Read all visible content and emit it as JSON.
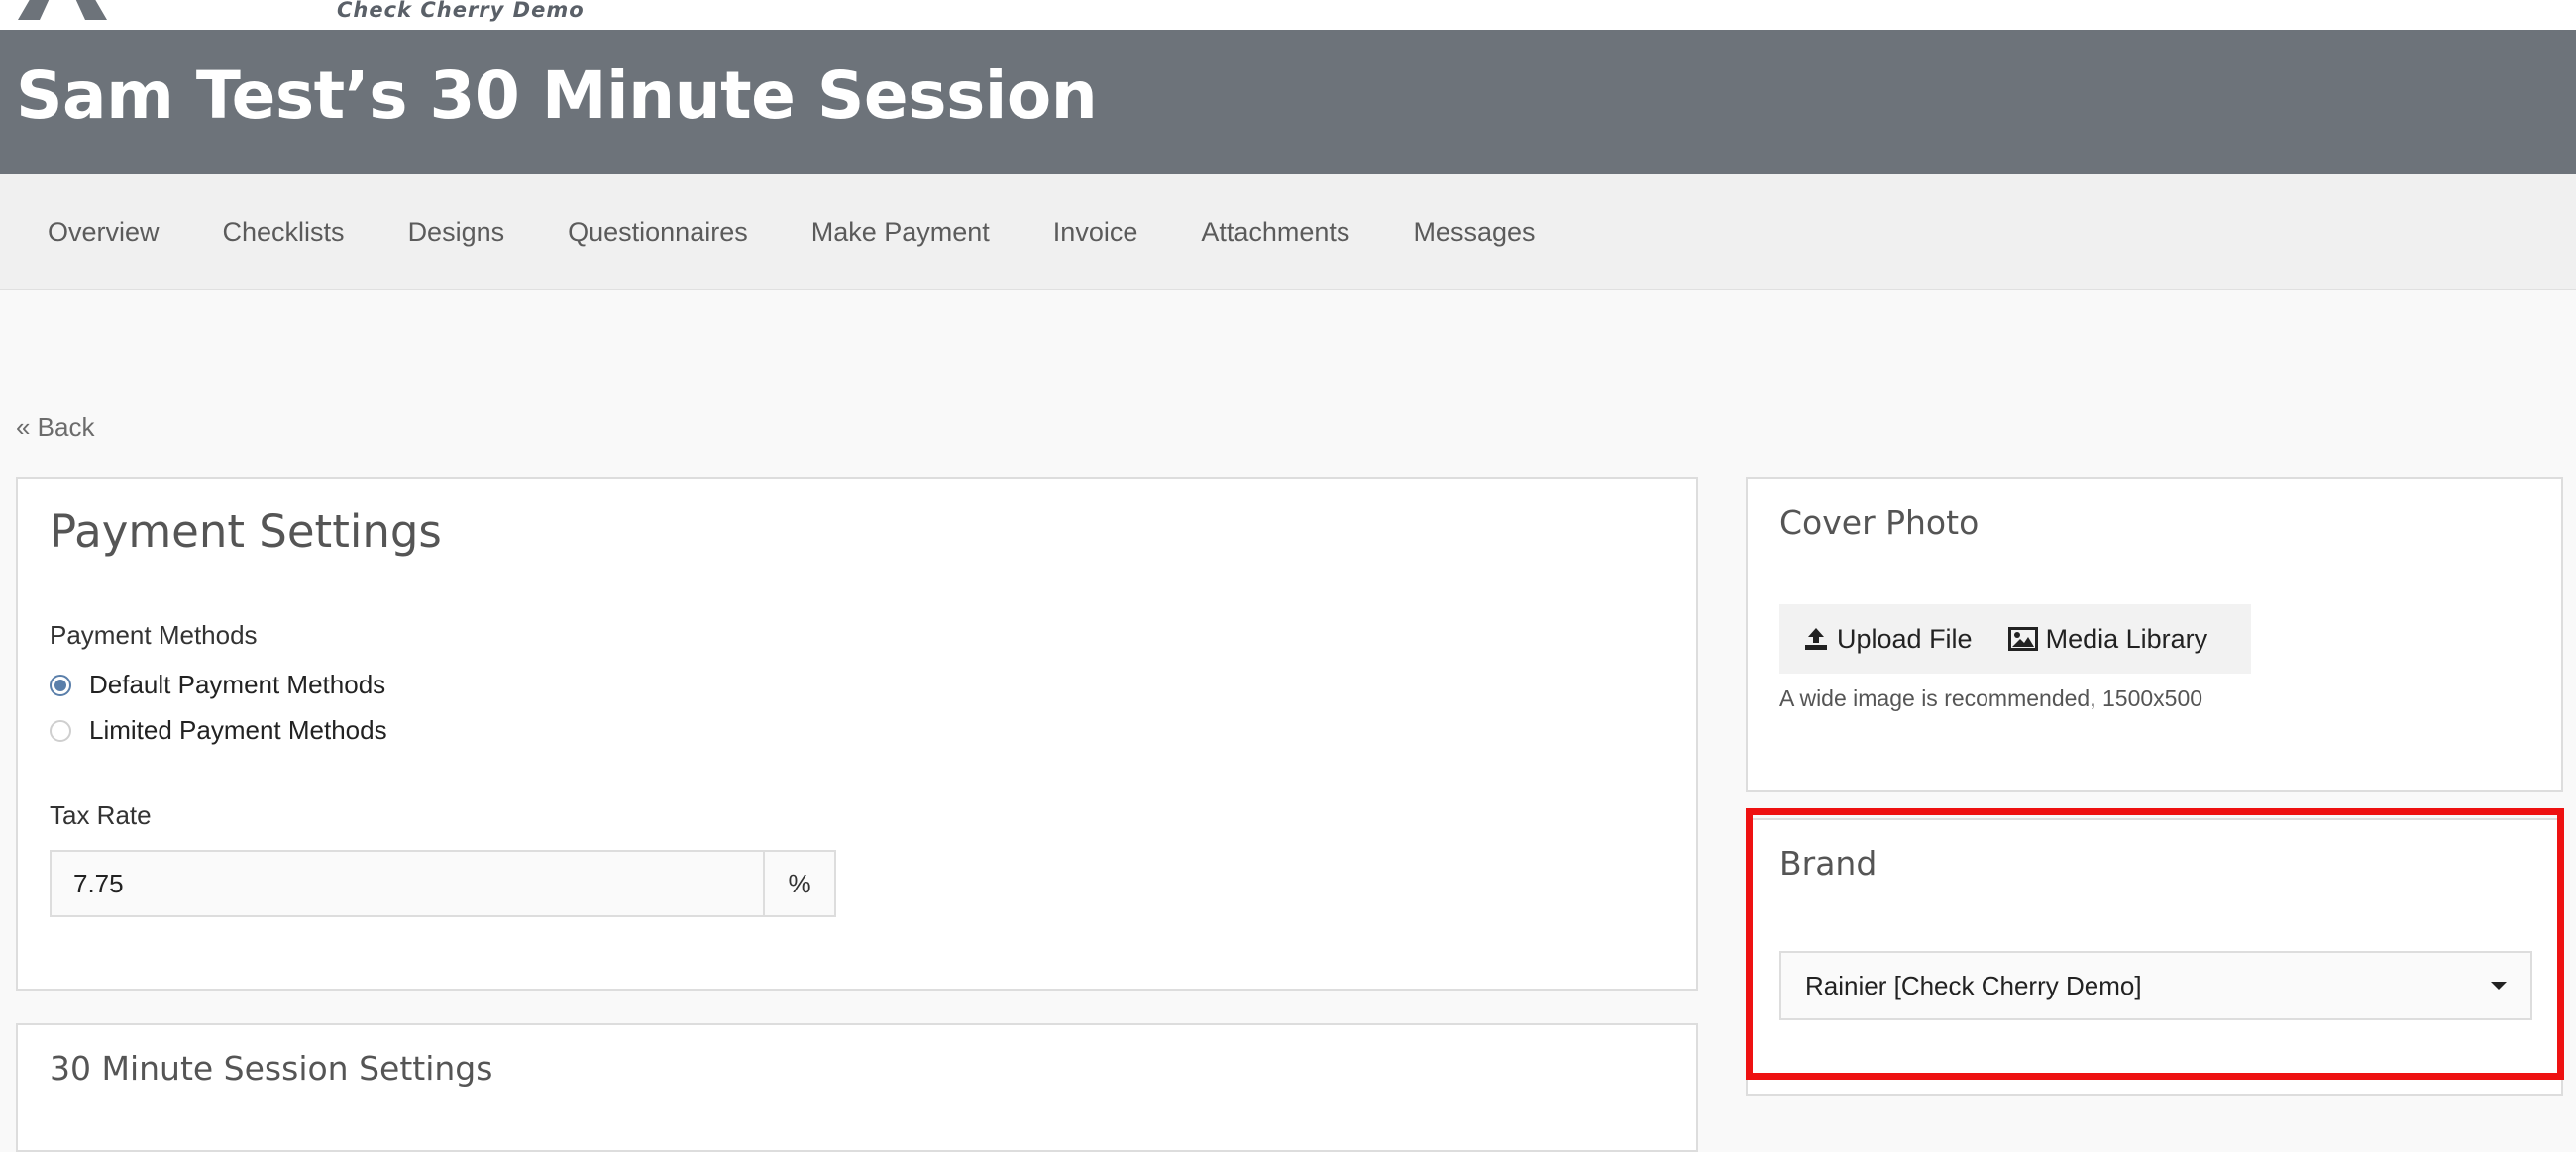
{
  "topbar": {
    "brand_subtitle": "Check Cherry Demo"
  },
  "header": {
    "title": "Sam Test’s 30 Minute Session"
  },
  "nav": {
    "items": [
      {
        "label": "Overview"
      },
      {
        "label": "Checklists"
      },
      {
        "label": "Designs"
      },
      {
        "label": "Questionnaires"
      },
      {
        "label": "Make Payment"
      },
      {
        "label": "Invoice"
      },
      {
        "label": "Attachments"
      },
      {
        "label": "Messages"
      }
    ]
  },
  "back": {
    "label": "« Back"
  },
  "payment_settings": {
    "title": "Payment Settings",
    "methods_label": "Payment Methods",
    "options": [
      {
        "label": "Default Payment Methods",
        "checked": true
      },
      {
        "label": "Limited Payment Methods",
        "checked": false
      }
    ],
    "tax_label": "Tax Rate",
    "tax_value": "7.75",
    "tax_unit": "%"
  },
  "session_settings": {
    "title": "30 Minute Session Settings"
  },
  "cover_photo": {
    "title": "Cover Photo",
    "upload_label": "Upload File",
    "media_label": "Media Library",
    "help": "A wide image is recommended, 1500x500"
  },
  "brand": {
    "title": "Brand",
    "selected": "Rainier [Check Cherry Demo]"
  },
  "colors": {
    "header_bg": "#6d737a",
    "radio_accent": "#5a7faa",
    "highlight": "#ee1111"
  }
}
